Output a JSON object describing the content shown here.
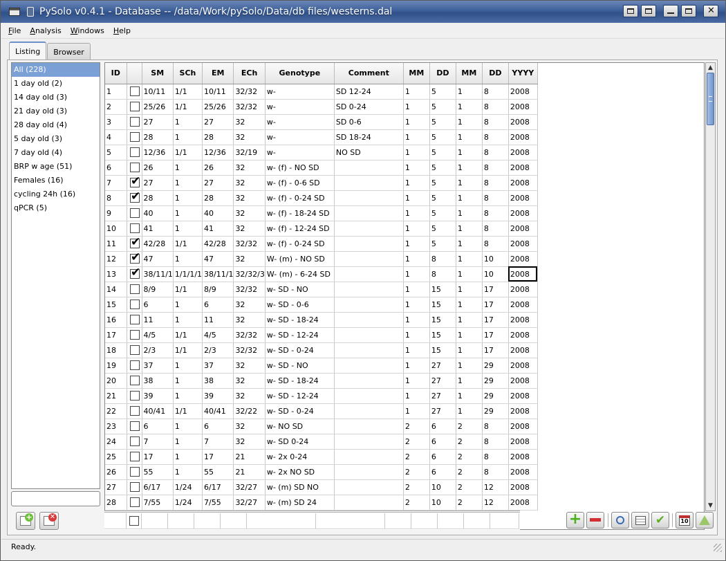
{
  "window": {
    "title": "PySolo v0.4.1 - Database -- /data/Work/pySolo/Data/db files/westerns.dal"
  },
  "menu": [
    {
      "u": "F",
      "rest": "ile"
    },
    {
      "u": "A",
      "rest": "nalysis"
    },
    {
      "u": "W",
      "rest": "indows"
    },
    {
      "u": "H",
      "rest": "elp"
    }
  ],
  "tabs": [
    {
      "label": "Listing",
      "active": true
    },
    {
      "label": "Browser",
      "active": false
    }
  ],
  "sidebar": {
    "items": [
      "All (228)",
      "1 day old (2)",
      "14 day old (3)",
      "21 day old (3)",
      "28 day old (4)",
      "5 day old (3)",
      "7 day old (4)",
      "BRP w age (51)",
      "Females (16)",
      "cycling 24h (16)",
      "qPCR (5)"
    ],
    "selected_index": 0,
    "filter_value": ""
  },
  "table": {
    "columns": [
      "ID",
      "",
      "SM",
      "SCh",
      "EM",
      "ECh",
      "Genotype",
      "Comment",
      "MM",
      "DD",
      "MM",
      "DD",
      "YYYY"
    ],
    "rows": [
      [
        "1",
        false,
        "10/11",
        "1/1",
        "10/11",
        "32/32",
        "w-",
        "SD 12-24",
        "1",
        "5",
        "1",
        "8",
        "2008"
      ],
      [
        "2",
        false,
        "25/26",
        "1/1",
        "25/26",
        "32/32",
        "w-",
        "SD 0-24",
        "1",
        "5",
        "1",
        "8",
        "2008"
      ],
      [
        "3",
        false,
        "27",
        "1",
        "27",
        "32",
        "w-",
        "SD 0-6",
        "1",
        "5",
        "1",
        "8",
        "2008"
      ],
      [
        "4",
        false,
        "28",
        "1",
        "28",
        "32",
        "w-",
        "SD 18-24",
        "1",
        "5",
        "1",
        "8",
        "2008"
      ],
      [
        "5",
        false,
        "12/36",
        "1/1",
        "12/36",
        "32/19",
        "w-",
        "NO SD",
        "1",
        "5",
        "1",
        "8",
        "2008"
      ],
      [
        "6",
        false,
        "26",
        "1",
        "26",
        "32",
        "w- (f) - NO SD",
        "",
        "1",
        "5",
        "1",
        "8",
        "2008"
      ],
      [
        "7",
        true,
        "27",
        "1",
        "27",
        "32",
        "w- (f) - 0-6 SD",
        "",
        "1",
        "5",
        "1",
        "8",
        "2008"
      ],
      [
        "8",
        true,
        "28",
        "1",
        "28",
        "32",
        "w- (f) - 0-24 SD",
        "",
        "1",
        "5",
        "1",
        "8",
        "2008"
      ],
      [
        "9",
        false,
        "40",
        "1",
        "40",
        "32",
        "w- (f) - 18-24 SD",
        "",
        "1",
        "5",
        "1",
        "8",
        "2008"
      ],
      [
        "10",
        false,
        "41",
        "1",
        "41",
        "32",
        "w- (f) - 12-24 SD",
        "",
        "1",
        "5",
        "1",
        "8",
        "2008"
      ],
      [
        "11",
        true,
        "42/28",
        "1/1",
        "42/28",
        "32/32",
        "w- (f) - 0-24 SD",
        "",
        "1",
        "5",
        "1",
        "8",
        "2008"
      ],
      [
        "12",
        true,
        "47",
        "1",
        "47",
        "32",
        "W- (m) - NO SD",
        "",
        "1",
        "8",
        "1",
        "10",
        "2008"
      ],
      [
        "13",
        true,
        "38/11/1",
        "1/1/1/1",
        "38/11/1",
        "32/32/3",
        "W- (m) - 6-24 SD",
        "",
        "1",
        "8",
        "1",
        "10",
        "2008"
      ],
      [
        "14",
        false,
        "8/9",
        "1/1",
        "8/9",
        "32/32",
        "w- SD - NO",
        "",
        "1",
        "15",
        "1",
        "17",
        "2008"
      ],
      [
        "15",
        false,
        "6",
        "1",
        "6",
        "32",
        "w- SD - 0-6",
        "",
        "1",
        "15",
        "1",
        "17",
        "2008"
      ],
      [
        "16",
        false,
        "11",
        "1",
        "11",
        "32",
        "w- SD - 18-24",
        "",
        "1",
        "15",
        "1",
        "17",
        "2008"
      ],
      [
        "17",
        false,
        "4/5",
        "1/1",
        "4/5",
        "32/32",
        "w- SD - 12-24",
        "",
        "1",
        "15",
        "1",
        "17",
        "2008"
      ],
      [
        "18",
        false,
        "2/3",
        "1/1",
        "2/3",
        "32/32",
        "w- SD - 0-24",
        "",
        "1",
        "15",
        "1",
        "17",
        "2008"
      ],
      [
        "19",
        false,
        "37",
        "1",
        "37",
        "32",
        "w- SD - NO",
        "",
        "1",
        "27",
        "1",
        "29",
        "2008"
      ],
      [
        "20",
        false,
        "38",
        "1",
        "38",
        "32",
        "w- SD - 18-24",
        "",
        "1",
        "27",
        "1",
        "29",
        "2008"
      ],
      [
        "21",
        false,
        "39",
        "1",
        "39",
        "32",
        "w- SD - 12-24",
        "",
        "1",
        "27",
        "1",
        "29",
        "2008"
      ],
      [
        "22",
        false,
        "40/41",
        "1/1",
        "40/41",
        "32/22",
        "w- SD - 0-24",
        "",
        "1",
        "27",
        "1",
        "29",
        "2008"
      ],
      [
        "23",
        false,
        "6",
        "1",
        "6",
        "32",
        "w- NO SD",
        "",
        "2",
        "6",
        "2",
        "8",
        "2008"
      ],
      [
        "24",
        false,
        "7",
        "1",
        "7",
        "32",
        "w- SD 0-24",
        "",
        "2",
        "6",
        "2",
        "8",
        "2008"
      ],
      [
        "25",
        false,
        "17",
        "1",
        "17",
        "21",
        "w- 2x 0-24",
        "",
        "2",
        "6",
        "2",
        "8",
        "2008"
      ],
      [
        "26",
        false,
        "55",
        "1",
        "55",
        "21",
        "w- 2x NO SD",
        "",
        "2",
        "6",
        "2",
        "8",
        "2008"
      ],
      [
        "27",
        false,
        "6/17",
        "1/24",
        "6/17",
        "32/27",
        "w- (m) SD NO",
        "",
        "2",
        "10",
        "2",
        "12",
        "2008"
      ],
      [
        "28",
        false,
        "7/55",
        "1/24",
        "7/55",
        "32/27",
        "w- (m) SD 24",
        "",
        "2",
        "10",
        "2",
        "12",
        "2008"
      ]
    ],
    "selected_cell": {
      "row": 12,
      "col": 12
    }
  },
  "toolbar": {
    "calendar_day": "10"
  },
  "status": {
    "text": "Ready."
  },
  "colors": {
    "titlebar": "#3d5f99",
    "selection": "#7ba0d6",
    "add": "#4caf1e",
    "remove": "#d33030"
  }
}
